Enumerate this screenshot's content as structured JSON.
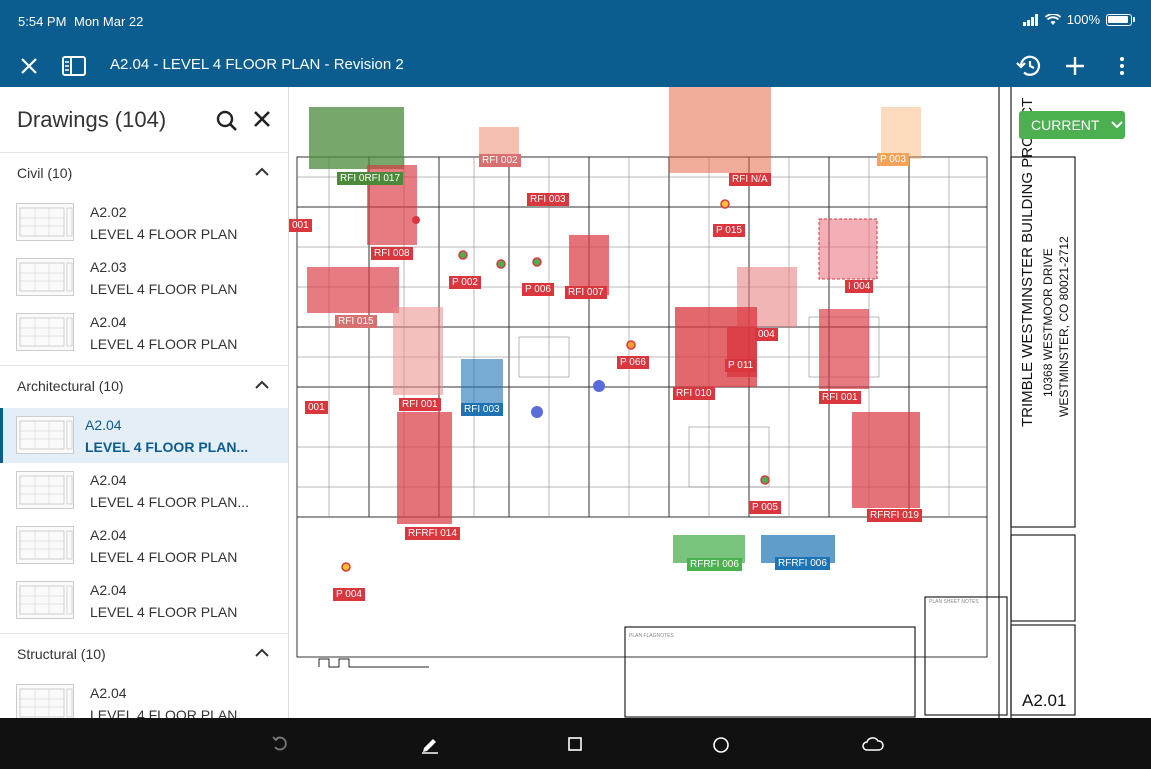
{
  "status": {
    "time": "5:54 PM",
    "date": "Mon Mar 22",
    "battery": "100%"
  },
  "header": {
    "title": "A2.04 - LEVEL 4 FLOOR PLAN - Revision 2"
  },
  "sidebar": {
    "title": "Drawings (104)",
    "sections": [
      {
        "label": "Civil (10)",
        "items": [
          {
            "num": "A2.02",
            "name": "LEVEL 4 FLOOR PLAN"
          },
          {
            "num": "A2.03",
            "name": "LEVEL 4 FLOOR PLAN"
          },
          {
            "num": "A2.04",
            "name": "LEVEL 4 FLOOR PLAN"
          }
        ]
      },
      {
        "label": "Architectural (10)",
        "items": [
          {
            "num": "A2.04",
            "name": "LEVEL 4 FLOOR PLAN...",
            "active": true
          },
          {
            "num": "A2.04",
            "name": "LEVEL 4 FLOOR PLAN..."
          },
          {
            "num": "A2.04",
            "name": "LEVEL 4 FLOOR PLAN"
          },
          {
            "num": "A2.04",
            "name": "LEVEL 4 FLOOR PLAN"
          }
        ]
      },
      {
        "label": "Structural (10)",
        "items": [
          {
            "num": "A2.04",
            "name": "LEVEL 4 FLOOR PLAN"
          }
        ]
      }
    ]
  },
  "current_button": {
    "label": "CURRENT"
  },
  "title_block": {
    "project": "TRIMBLE WESTMINSTER BUILDING PROJECT",
    "address1": "10368 WESTMOOR DRIVE",
    "address2": "WESTMINSTER, CO 80021-2712",
    "sheet": "A2.01"
  },
  "markups": {
    "rfi_001_left": "001",
    "rfi_002": "RFI 002",
    "rfi_017": "RFI 0RFI 017",
    "rfi_na": "RFI N/A",
    "rfi_003_top": "RFI 003",
    "p_003": "P 003",
    "p_015": "P 015",
    "rfi_008": "RFI 008",
    "p_002": "P 002",
    "p_006": "P 006",
    "rfi_007": "RFI 007",
    "i_004": "I 004",
    "rfi_015": "RFI 015",
    "p_004_mid": "004",
    "p_066": "P 066",
    "p_011": "P 011",
    "rfi_010": "RFI 010",
    "rfi_001_right": "RFI 001",
    "num_001": "001",
    "rfi_001_mid": "RFI 001",
    "rfi_003_blue": "RFI 003",
    "p_005": "P 005",
    "rfi_019": "RFRFI 019",
    "rfi_014": "RFRFI 014",
    "rfi_006_green": "RFRFI 006",
    "rfi_006_blue": "RFRFI 006",
    "p_004_bottom": "P 004"
  },
  "colors": {
    "header": "#0b5c8f",
    "accent": "#4caf50",
    "markup_red": "#d9363e",
    "markup_blue": "#1e73b5"
  }
}
